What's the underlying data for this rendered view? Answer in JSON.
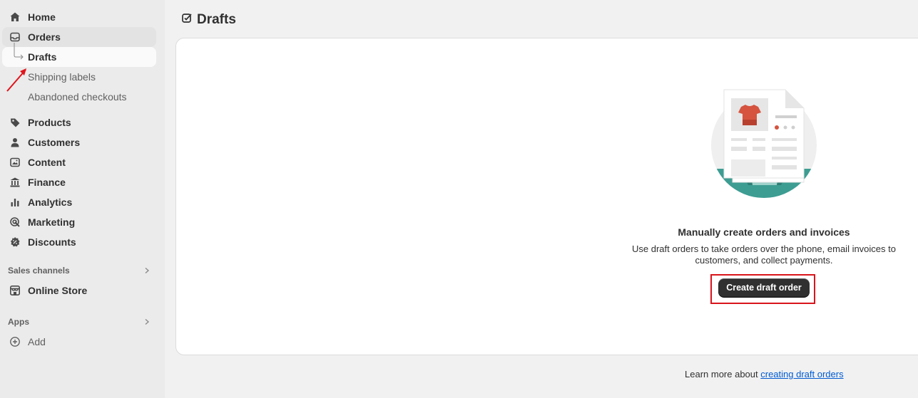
{
  "sidebar": {
    "home": "Home",
    "orders": "Orders",
    "orders_sub": [
      "Drafts",
      "Shipping labels",
      "Abandoned checkouts"
    ],
    "products": "Products",
    "customers": "Customers",
    "content": "Content",
    "finance": "Finance",
    "analytics": "Analytics",
    "marketing": "Marketing",
    "discounts": "Discounts",
    "sales_channels": "Sales channels",
    "online_store": "Online Store",
    "apps": "Apps",
    "add": "Add"
  },
  "page": {
    "title": "Drafts"
  },
  "empty_state": {
    "heading": "Manually create orders and invoices",
    "body": "Use draft orders to take orders over the phone, email invoices to customers, and collect payments.",
    "button": "Create draft order"
  },
  "footer": {
    "text": "Learn more about",
    "link": "creating draft orders"
  },
  "colors": {
    "accent": "#303030",
    "link": "#005bd3",
    "highlight": "#d9141b",
    "illustration_teal": "#3d9d92",
    "illustration_red": "#d5533f"
  }
}
